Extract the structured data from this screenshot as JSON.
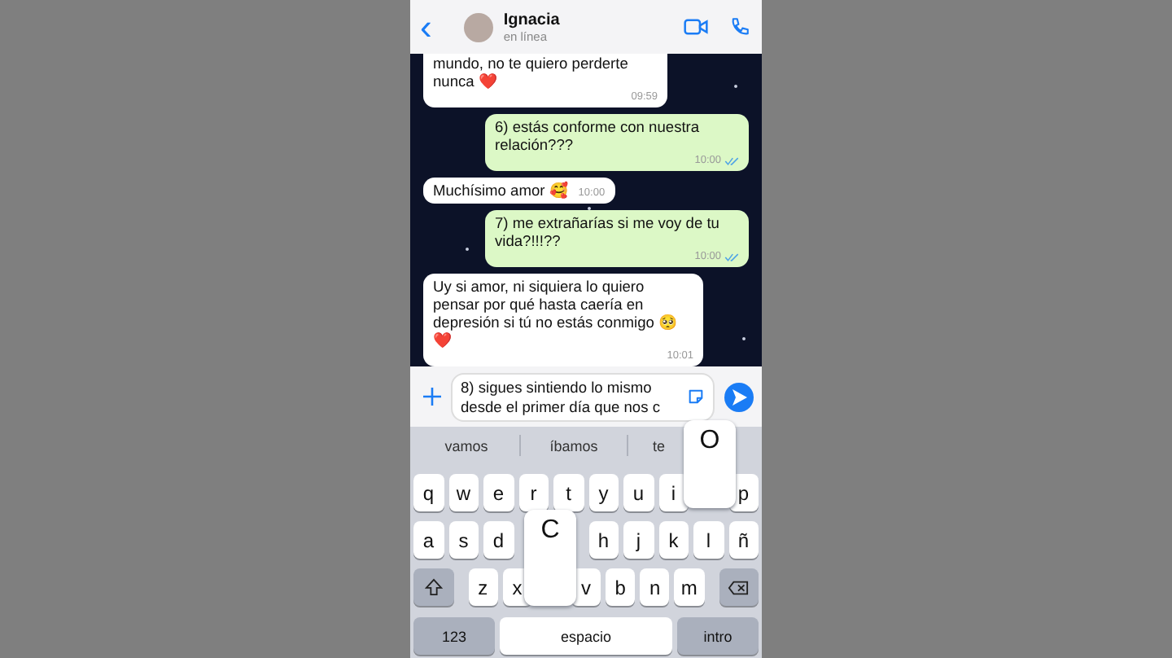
{
  "header": {
    "back": "‹",
    "name": "Ignacia",
    "status": "en línea"
  },
  "messages": [
    {
      "kind": "received",
      "text": "mundo, no te quiero perderte nunca ❤️",
      "time": "09:59"
    },
    {
      "kind": "sent",
      "text": "6) estás conforme con nuestra relación???",
      "time": "10:00",
      "read": true
    },
    {
      "kind": "received",
      "text": "Muchísimo amor 🥰",
      "time": "10:00"
    },
    {
      "kind": "sent",
      "text": "7) me extrañarías si me voy de tu vida?!!!??",
      "time": "10:00",
      "read": true
    },
    {
      "kind": "received",
      "text": "Uy si amor, ni siquiera lo quiero pensar por qué hasta caería en depresión si tú no estás conmigo 🥺❤️",
      "time": "10:01"
    }
  ],
  "composer": {
    "value": "8) sigues sintiendo lo mismo desde el primer día que nos c"
  },
  "suggestions": [
    "vamos",
    "íbamos",
    "te"
  ],
  "key_popups": [
    {
      "label": "O"
    },
    {
      "label": "C"
    }
  ],
  "keyboard": {
    "rows": [
      [
        {
          "kind": "letter",
          "label": "q"
        },
        {
          "kind": "letter",
          "label": "w"
        },
        {
          "kind": "letter",
          "label": "e"
        },
        {
          "kind": "letter",
          "label": "r"
        },
        {
          "kind": "letter",
          "label": "t"
        },
        {
          "kind": "letter",
          "label": "y"
        },
        {
          "kind": "letter",
          "label": "u"
        },
        {
          "kind": "letter",
          "label": "i"
        },
        {
          "kind": "covered"
        },
        {
          "kind": "letter",
          "label": "p"
        }
      ],
      [
        {
          "kind": "letter",
          "label": "a"
        },
        {
          "kind": "letter",
          "label": "s"
        },
        {
          "kind": "letter",
          "label": "d"
        },
        {
          "kind": "covered"
        },
        {
          "kind": "covered"
        },
        {
          "kind": "letter",
          "label": "h"
        },
        {
          "kind": "letter",
          "label": "j"
        },
        {
          "kind": "letter",
          "label": "k"
        },
        {
          "kind": "letter",
          "label": "l"
        },
        {
          "kind": "letter",
          "label": "ñ"
        }
      ],
      [
        {
          "kind": "shift"
        },
        {
          "kind": "letter",
          "label": "z"
        },
        {
          "kind": "letter",
          "label": "x"
        },
        {
          "kind": "covered"
        },
        {
          "kind": "letter",
          "label": "v"
        },
        {
          "kind": "letter",
          "label": "b"
        },
        {
          "kind": "letter",
          "label": "n"
        },
        {
          "kind": "letter",
          "label": "m"
        },
        {
          "kind": "backspace"
        }
      ]
    ],
    "bottom_keys": [
      {
        "kind": "mode",
        "label": "123"
      },
      {
        "kind": "space",
        "label": "espacio"
      },
      {
        "kind": "mode",
        "label": "intro"
      }
    ]
  }
}
